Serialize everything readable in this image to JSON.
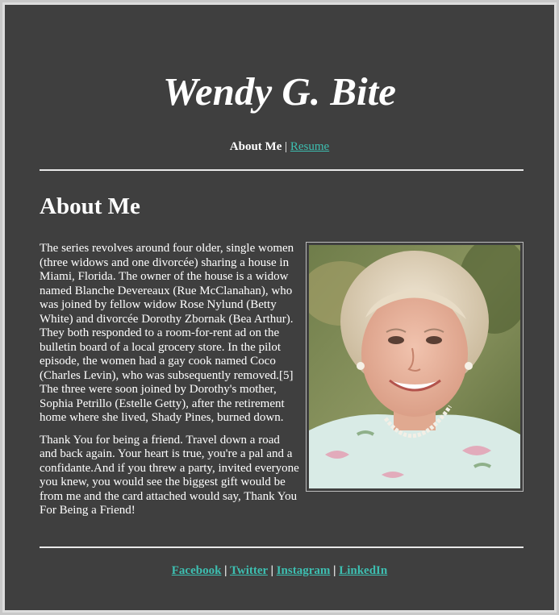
{
  "site_title": "Wendy G. Bite",
  "nav": {
    "current": "About Me",
    "separator": "|",
    "resume": "Resume"
  },
  "section_heading": "About Me",
  "paragraphs": [
    "The series revolves around four older, single women (three widows and one divorcée) sharing a house in Miami, Florida. The owner of the house is a widow named Blanche Devereaux (Rue McClanahan), who was joined by fellow widow Rose Nylund (Betty White) and divorcée Dorothy Zbornak (Bea Arthur). They both responded to a room-for-rent ad on the bulletin board of a local grocery store. In the pilot episode, the women had a gay cook named Coco (Charles Levin), who was subsequently removed.[5] The three were soon joined by Dorothy's mother, Sophia Petrillo (Estelle Getty), after the retirement home where she lived, Shady Pines, burned down.",
    "Thank You for being a friend. Travel down a road and back again. Your heart is true, you're a pal and a confidante.And if you threw a party, invited everyone you knew, you would see the biggest gift would be from me and the card attached would say, Thank You For Being a Friend!"
  ],
  "footer": {
    "links": [
      "Facebook",
      "Twitter",
      "Instagram",
      "LinkedIn"
    ],
    "separator": "|"
  },
  "colors": {
    "background": "#3f3f3f",
    "link": "#3dbfb1",
    "text": "#ffffff"
  }
}
